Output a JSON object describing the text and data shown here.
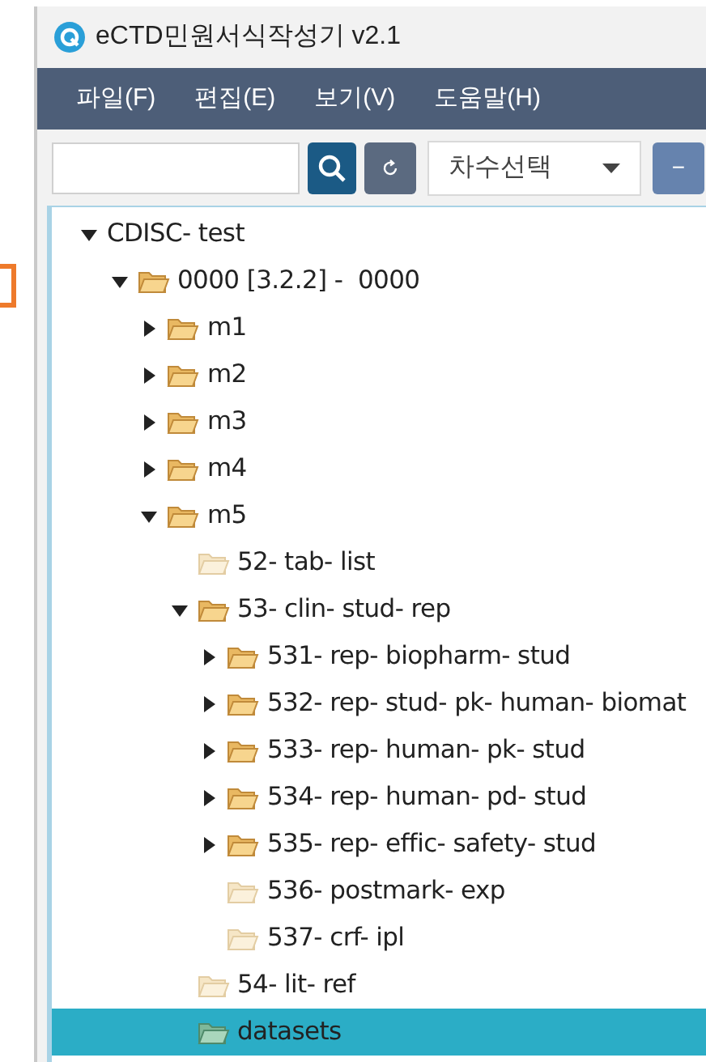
{
  "window": {
    "title": "eCTD민원서식작성기 v2.1"
  },
  "menu": [
    "파일(F)",
    "편집(E)",
    "보기(V)",
    "도움말(H)"
  ],
  "toolbar": {
    "version_select": {
      "value": "차수선택"
    },
    "minus_label": "−"
  },
  "tree": [
    {
      "label": "CDISC- test",
      "kind": "root",
      "expanded": true,
      "selected": false,
      "children": [
        {
          "label": "0000 [3.2.2] -  0000",
          "kind": "branch",
          "expanded": true,
          "selected": false,
          "children": [
            {
              "label": "m1",
              "kind": "branch",
              "expanded": false,
              "selected": false
            },
            {
              "label": "m2",
              "kind": "branch",
              "expanded": false,
              "selected": false
            },
            {
              "label": "m3",
              "kind": "branch",
              "expanded": false,
              "selected": false
            },
            {
              "label": "m4",
              "kind": "branch",
              "expanded": false,
              "selected": false
            },
            {
              "label": "m5",
              "kind": "branch",
              "expanded": true,
              "selected": false,
              "children": [
                {
                  "label": "52- tab- list",
                  "kind": "leaf",
                  "selected": false
                },
                {
                  "label": "53- clin- stud- rep",
                  "kind": "branch",
                  "expanded": true,
                  "selected": false,
                  "children": [
                    {
                      "label": "531- rep- biopharm- stud",
                      "kind": "branch",
                      "expanded": false,
                      "selected": false
                    },
                    {
                      "label": "532- rep- stud- pk- human- biomat",
                      "kind": "branch",
                      "expanded": false,
                      "selected": false
                    },
                    {
                      "label": "533- rep- human- pk- stud",
                      "kind": "branch",
                      "expanded": false,
                      "selected": false
                    },
                    {
                      "label": "534- rep- human- pd- stud",
                      "kind": "branch",
                      "expanded": false,
                      "selected": false
                    },
                    {
                      "label": "535- rep- effic- safety- stud",
                      "kind": "branch",
                      "expanded": false,
                      "selected": false
                    },
                    {
                      "label": "536- postmark- exp",
                      "kind": "leaf",
                      "selected": false
                    },
                    {
                      "label": "537- crf- ipl",
                      "kind": "leaf",
                      "selected": false
                    }
                  ]
                },
                {
                  "label": "54- lit- ref",
                  "kind": "leaf",
                  "selected": false
                },
                {
                  "label": "datasets",
                  "kind": "leaf",
                  "selected": true
                }
              ]
            }
          ]
        }
      ]
    }
  ]
}
